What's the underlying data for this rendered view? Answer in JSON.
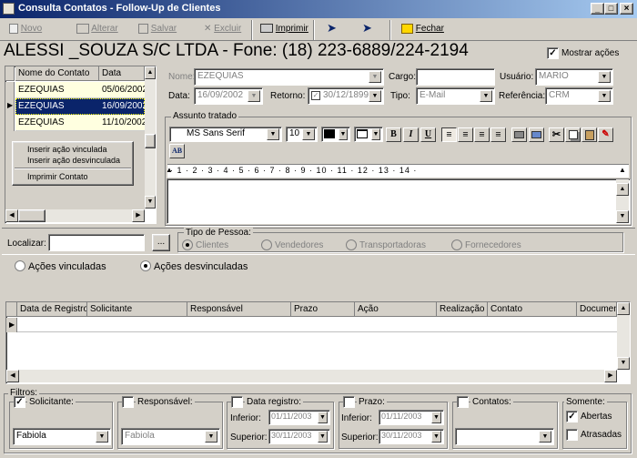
{
  "window": {
    "title": "Consulta Contatos - Follow-Up de Clientes"
  },
  "toolbar": {
    "novo": "Novo",
    "alterar": "Alterar",
    "salvar": "Salvar",
    "excluir": "Excluir",
    "imprimir": "Imprimir",
    "fechar": "Fechar"
  },
  "header": {
    "company": "ALESSI _SOUZA S/C LTDA -  Fone: (18) 223-6889/224-2194",
    "mostrar_acoes": "Mostrar ações",
    "mostrar_acoes_checked": true
  },
  "contacts": {
    "columns": [
      "Nome do Contato",
      "Data"
    ],
    "rows": [
      {
        "nome": "EZEQUIAS",
        "data": "05/06/2002"
      },
      {
        "nome": "EZEQUIAS",
        "data": "16/09/2002"
      },
      {
        "nome": "EZEQUIAS",
        "data": "11/10/2002"
      }
    ],
    "selected_index": 1
  },
  "context_menu": {
    "items": [
      "Inserir ação vinculada",
      "Inserir ação desvinculada",
      "Imprimir Contato"
    ]
  },
  "form": {
    "nome_label": "Nome:",
    "nome_value": "EZEQUIAS",
    "cargo_label": "Cargo:",
    "cargo_value": "",
    "usuario_label": "Usuário:",
    "usuario_value": "MARIO",
    "data_label": "Data:",
    "data_value": "16/09/2002",
    "retorno_label": "Retorno:",
    "retorno_value": "30/12/1899",
    "tipo_label": "Tipo:",
    "tipo_value": "E-Mail",
    "referencia_label": "Referência:",
    "referencia_value": "CRM"
  },
  "editor": {
    "label": "Assunto tratado",
    "font": "MS Sans Serif",
    "size": "10",
    "ruler": "· 1 · 2 · 3 · 4 · 5 · 6 · 7 · 8 · 9 · 10 · 11 · 12 · 13 · 14 ·"
  },
  "search": {
    "label": "Localizar:",
    "value": "",
    "btn": "..."
  },
  "tipo_pessoa": {
    "label": "Tipo de Pessoa:",
    "options": [
      "Clientes",
      "Vendedores",
      "Transportadoras",
      "Fornecedores"
    ],
    "selected_index": 0
  },
  "actions": {
    "options": [
      "Ações vinculadas",
      "Ações desvinculadas"
    ],
    "selected_index": 1
  },
  "grid": {
    "columns": [
      "Data de Registro",
      "Solicitante",
      "Responsável",
      "Prazo",
      "Ação",
      "Realização",
      "Contato",
      "Documen"
    ]
  },
  "filters": {
    "label": "Filtros:",
    "solicitante": {
      "label": "Solicitante:",
      "checked": true,
      "value": "Fabiola"
    },
    "responsavel": {
      "label": "Responsável:",
      "checked": false,
      "value": "Fabiola"
    },
    "data_registro": {
      "label": "Data registro:",
      "checked": false,
      "inferior_label": "Inferior:",
      "inferior": "01/11/2003",
      "superior_label": "Superior:",
      "superior": "30/11/2003"
    },
    "prazo": {
      "label": "Prazo:",
      "checked": false,
      "inferior_label": "Inferior:",
      "inferior": "01/11/2003",
      "superior_label": "Superior:",
      "superior": "30/11/2003"
    },
    "contatos": {
      "label": "Contatos:",
      "checked": false,
      "value": ""
    },
    "somente": {
      "label": "Somente:",
      "abertas": "Abertas",
      "abertas_checked": true,
      "atrasadas": "Atrasadas",
      "atrasadas_checked": false
    }
  }
}
